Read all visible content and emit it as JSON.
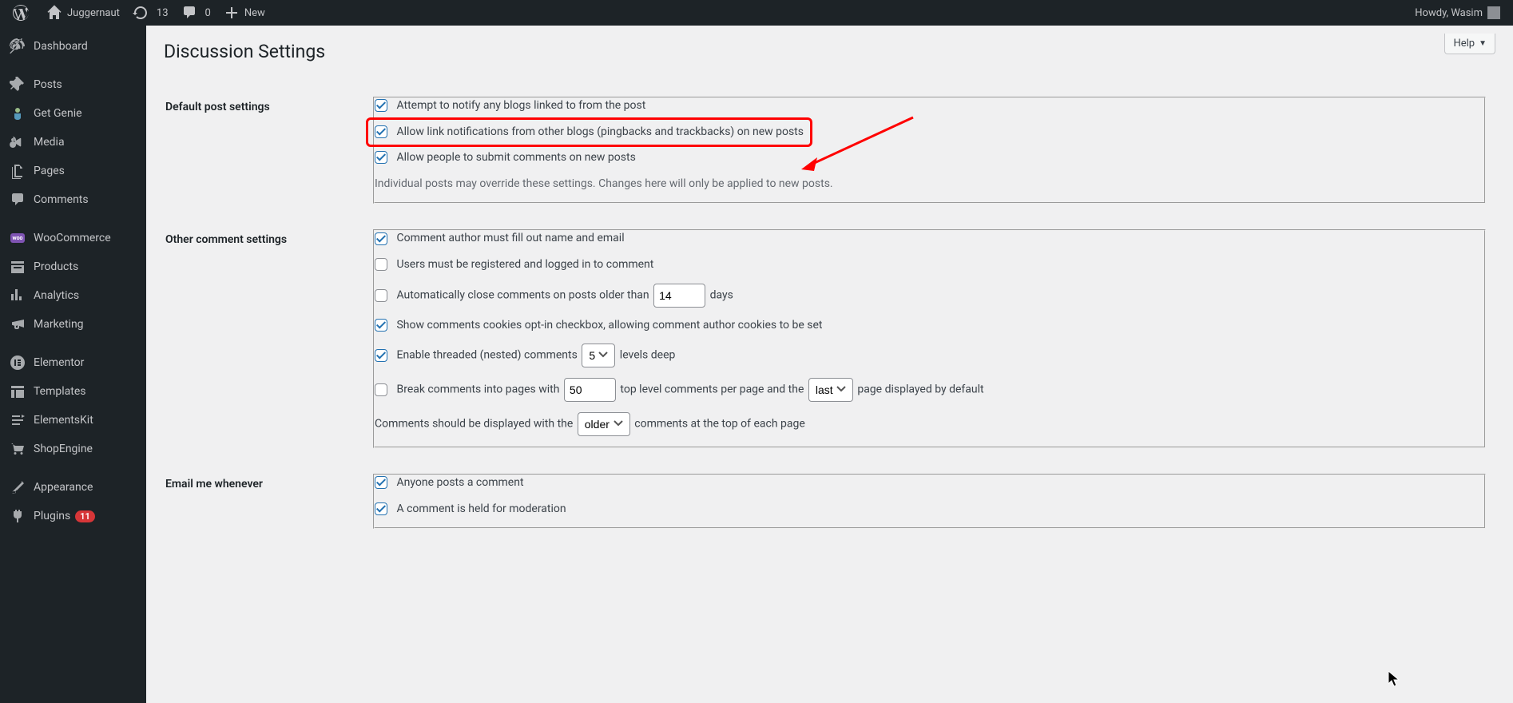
{
  "adminbar": {
    "site_name": "Juggernaut",
    "updates": "13",
    "comments": "0",
    "new_label": "New",
    "howdy": "Howdy, Wasim"
  },
  "sidebar": {
    "items": [
      {
        "label": "Dashboard"
      },
      {
        "label": "Posts"
      },
      {
        "label": "Get Genie"
      },
      {
        "label": "Media"
      },
      {
        "label": "Pages"
      },
      {
        "label": "Comments"
      },
      {
        "label": "WooCommerce"
      },
      {
        "label": "Products"
      },
      {
        "label": "Analytics"
      },
      {
        "label": "Marketing"
      },
      {
        "label": "Elementor"
      },
      {
        "label": "Templates"
      },
      {
        "label": "ElementsKit"
      },
      {
        "label": "ShopEngine"
      },
      {
        "label": "Appearance"
      },
      {
        "label": "Plugins",
        "badge": "11"
      }
    ]
  },
  "content": {
    "help": "Help",
    "title": "Discussion Settings",
    "sections": {
      "default_post": {
        "heading": "Default post settings",
        "opt1": "Attempt to notify any blogs linked to from the post",
        "opt2": "Allow link notifications from other blogs (pingbacks and trackbacks) on new posts",
        "opt3": "Allow people to submit comments on new posts",
        "note": "Individual posts may override these settings. Changes here will only be applied to new posts."
      },
      "other_comment": {
        "heading": "Other comment settings",
        "c1": "Comment author must fill out name and email",
        "c2": "Users must be registered and logged in to comment",
        "c3_before": "Automatically close comments on posts older than ",
        "c3_days_value": "14",
        "c3_after": " days",
        "c4": "Show comments cookies opt-in checkbox, allowing comment author cookies to be set",
        "c5_before": "Enable threaded (nested) comments ",
        "c5_levels_value": "5",
        "c5_after": " levels deep",
        "c6_before": "Break comments into pages with ",
        "c6_perpage_value": "50",
        "c6_mid": " top level comments per page and the ",
        "c6_select_value": "last",
        "c6_after": " page displayed by default",
        "c7_before": "Comments should be displayed with the ",
        "c7_select_value": "older",
        "c7_after": " comments at the top of each page"
      },
      "email": {
        "heading": "Email me whenever",
        "e1": "Anyone posts a comment",
        "e2": "A comment is held for moderation"
      }
    }
  }
}
